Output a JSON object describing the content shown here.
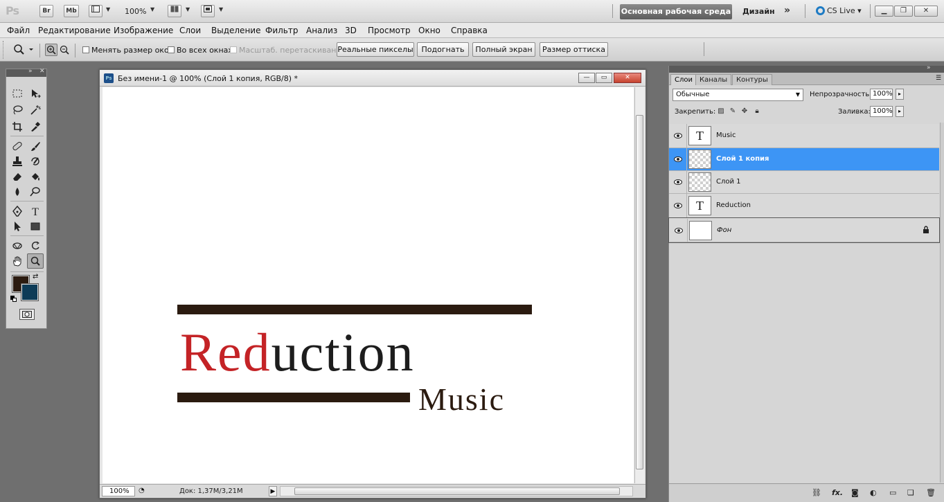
{
  "appbar": {
    "logo": "Ps",
    "bridge": "Br",
    "minibridge": "Mb",
    "zoom": "100%",
    "workspace_active": "Основная рабочая среда",
    "workspace_design": "Дизайн",
    "more": "»",
    "cslive": "CS Live"
  },
  "menu": [
    "Файл",
    "Редактирование",
    "Изображение",
    "Слои",
    "Выделение",
    "Фильтр",
    "Анализ",
    "3D",
    "Просмотр",
    "Окно",
    "Справка"
  ],
  "options": {
    "resize_windows": "Менять размер окон",
    "all_windows": "Во всех окнах",
    "scrubby_zoom": "Масштаб. перетаскиванием",
    "actual_pixels": "Реальные пикселы",
    "fit_screen": "Подогнать",
    "fill_screen": "Полный экран",
    "print_size": "Размер оттиска"
  },
  "colors": {
    "foreground": "#2b1b10",
    "background": "#0d3b57",
    "selected_layer": "#3d95f5"
  },
  "document": {
    "title": "Без имени-1 @ 100% (Слой 1 копия, RGB/8) *",
    "zoom": "100%",
    "doc_size": "Док: 1,37M/3,21M",
    "logo_red": "Red",
    "logo_dark": "uction",
    "logo_music": "Music"
  },
  "layers_panel": {
    "tabs": [
      "Слои",
      "Каналы",
      "Контуры"
    ],
    "blend_mode": "Обычные",
    "opacity_label": "Непрозрачность:",
    "opacity": "100%",
    "lock_label": "Закрепить:",
    "fill_label": "Заливка:",
    "fill": "100%",
    "layers": [
      {
        "name": "Music",
        "kind": "text"
      },
      {
        "name": "Слой 1 копия",
        "kind": "raster"
      },
      {
        "name": "Слой 1",
        "kind": "raster"
      },
      {
        "name": "Reduction",
        "kind": "text"
      },
      {
        "name": "Фон",
        "kind": "background"
      }
    ],
    "footer_fx": "fx."
  }
}
